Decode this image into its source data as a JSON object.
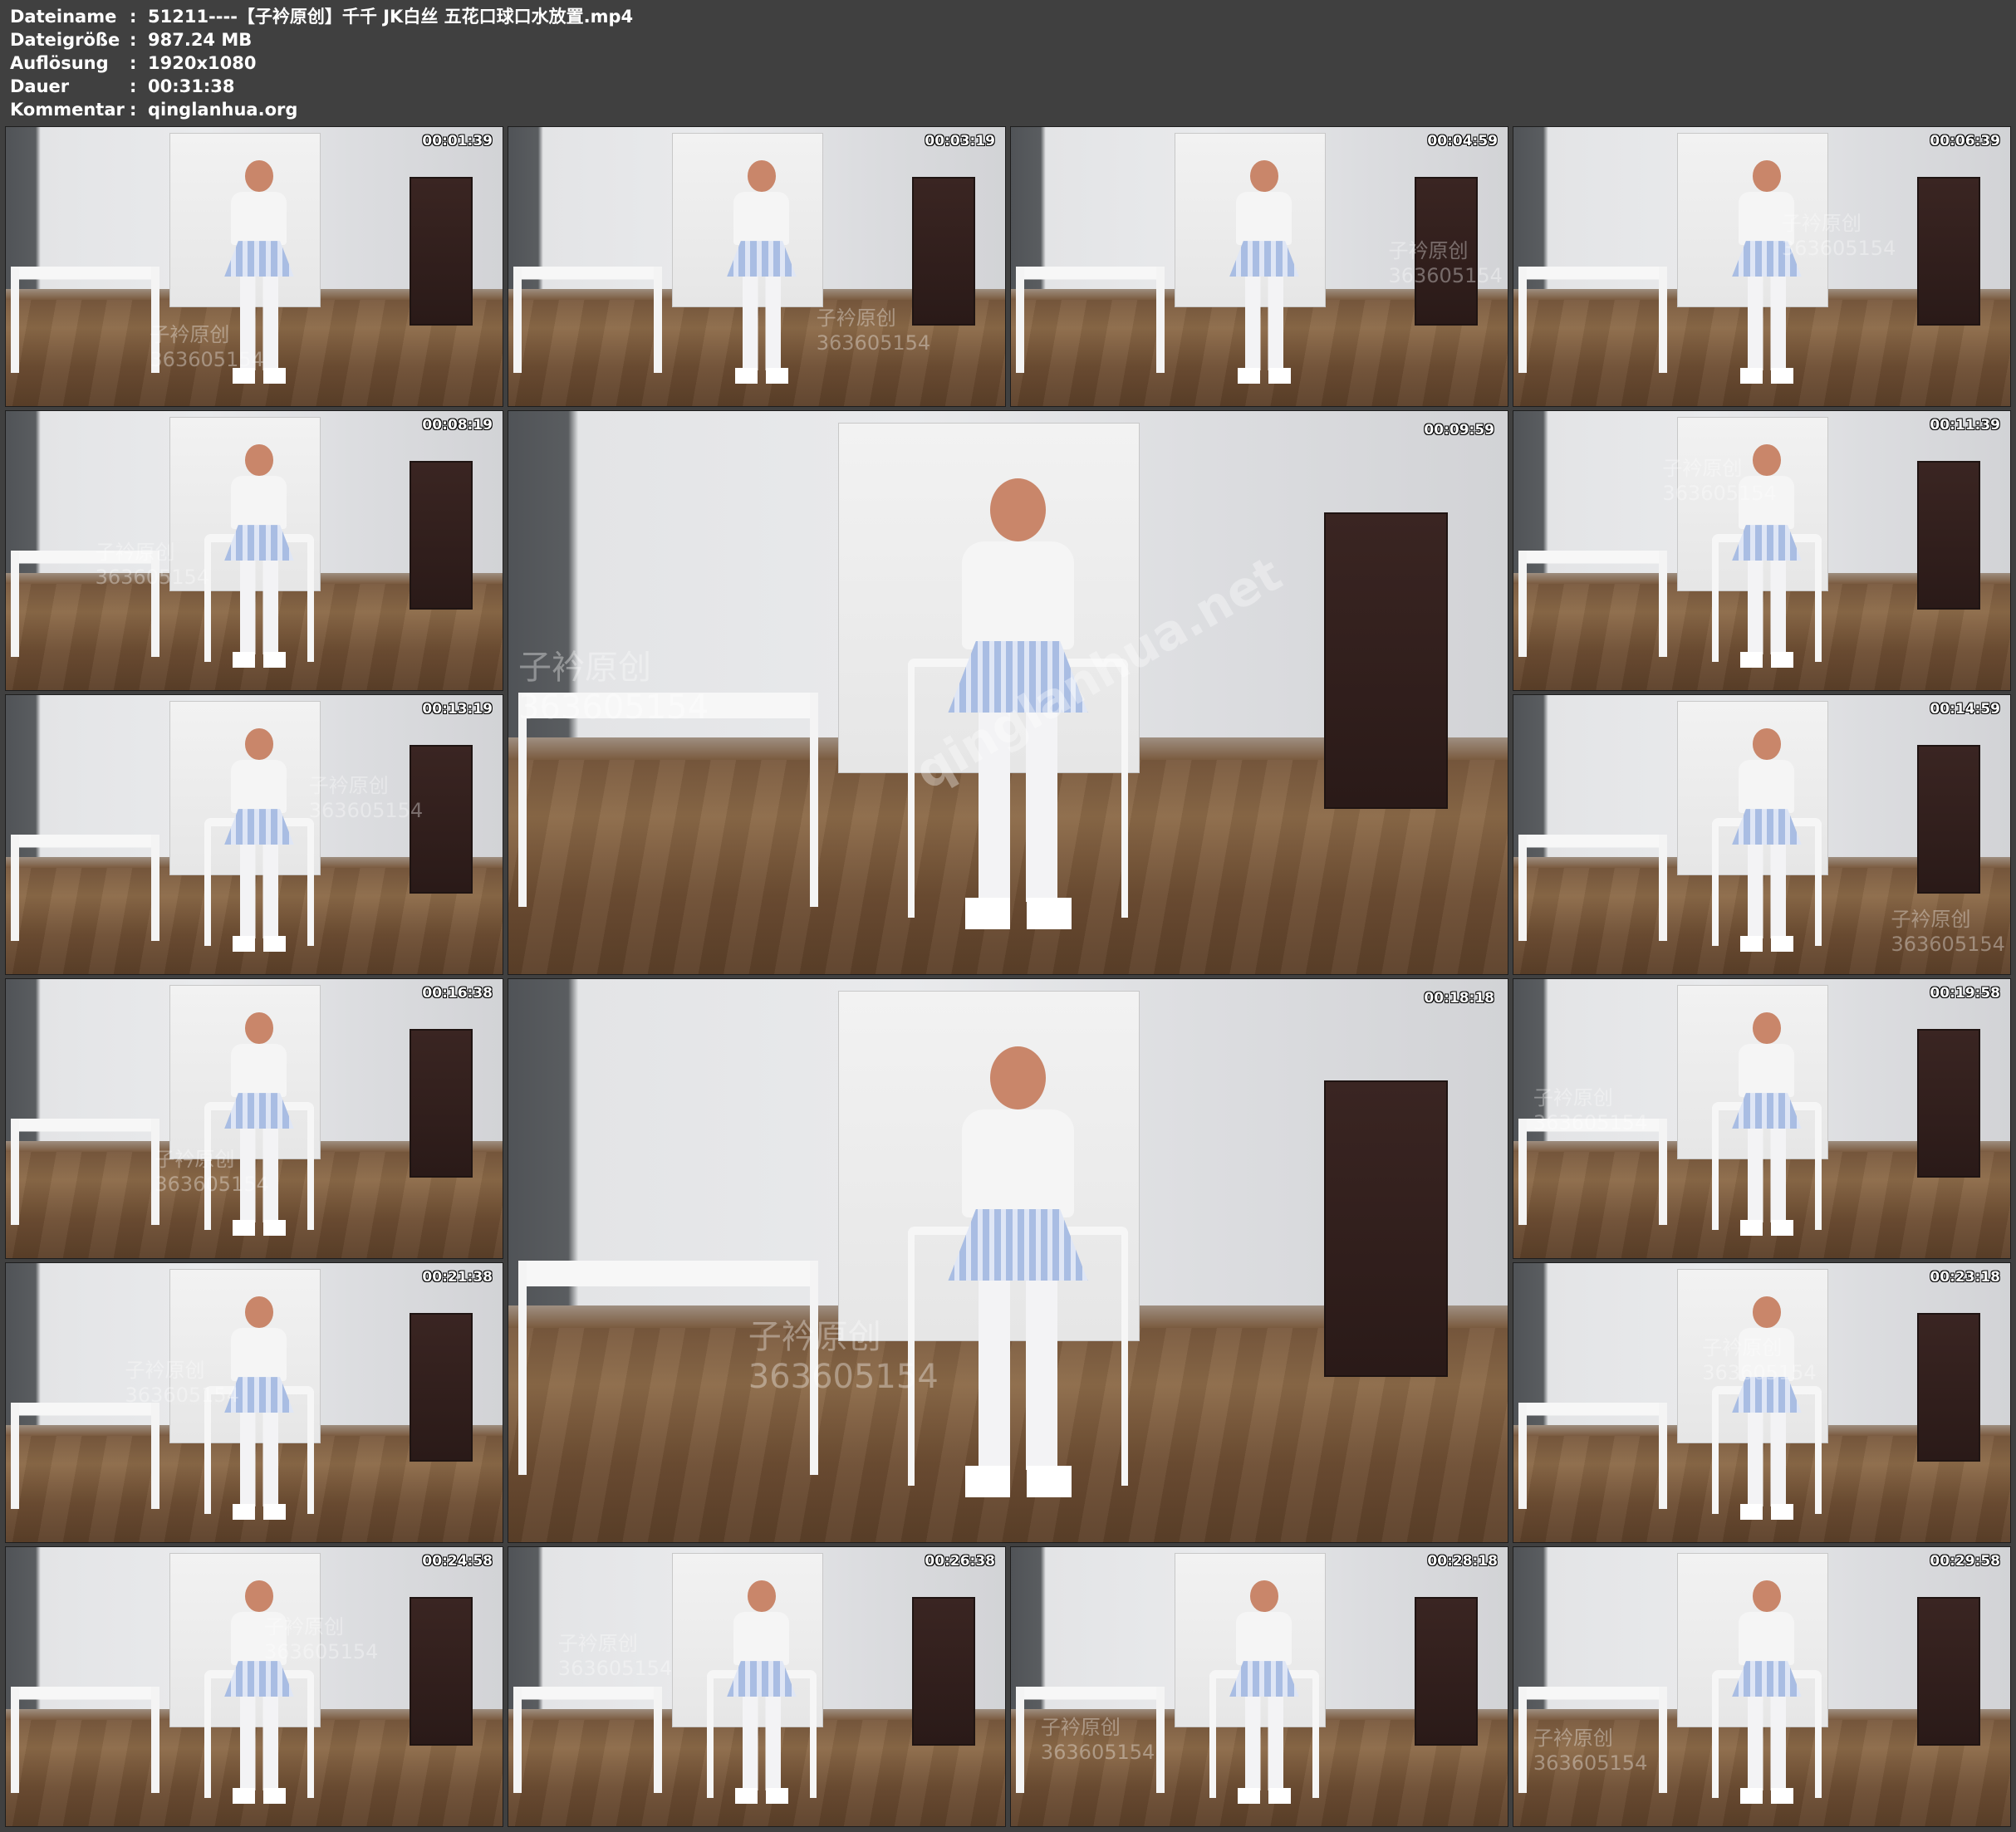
{
  "file_info": [
    {
      "label": "Dateiname",
      "value": "51211----【子衿原创】千千 JK白丝 五花口球口水放置.mp4"
    },
    {
      "label": "Dateigröße",
      "value": "987.24 MB"
    },
    {
      "label": "Auflösung",
      "value": "1920x1080"
    },
    {
      "label": "Dauer",
      "value": "00:31:38"
    },
    {
      "label": "Kommentar",
      "value": "qinglanhua.org"
    }
  ],
  "separator": ":",
  "watermarks": {
    "brand": "子衿原创",
    "number": "363605154",
    "site": "qinglanhua.net"
  },
  "thumbnails": [
    {
      "timestamp": "00:01:39"
    },
    {
      "timestamp": "00:03:19"
    },
    {
      "timestamp": "00:04:59"
    },
    {
      "timestamp": "00:06:39"
    },
    {
      "timestamp": "00:08:19"
    },
    {
      "timestamp": "00:09:59"
    },
    {
      "timestamp": "00:11:39"
    },
    {
      "timestamp": "00:13:19"
    },
    {
      "timestamp": "00:14:59"
    },
    {
      "timestamp": "00:16:38"
    },
    {
      "timestamp": "00:18:18"
    },
    {
      "timestamp": "00:19:58"
    },
    {
      "timestamp": "00:21:38"
    },
    {
      "timestamp": "00:23:18"
    },
    {
      "timestamp": "00:24:58"
    },
    {
      "timestamp": "00:26:38"
    },
    {
      "timestamp": "00:28:18"
    },
    {
      "timestamp": "00:29:58"
    }
  ]
}
